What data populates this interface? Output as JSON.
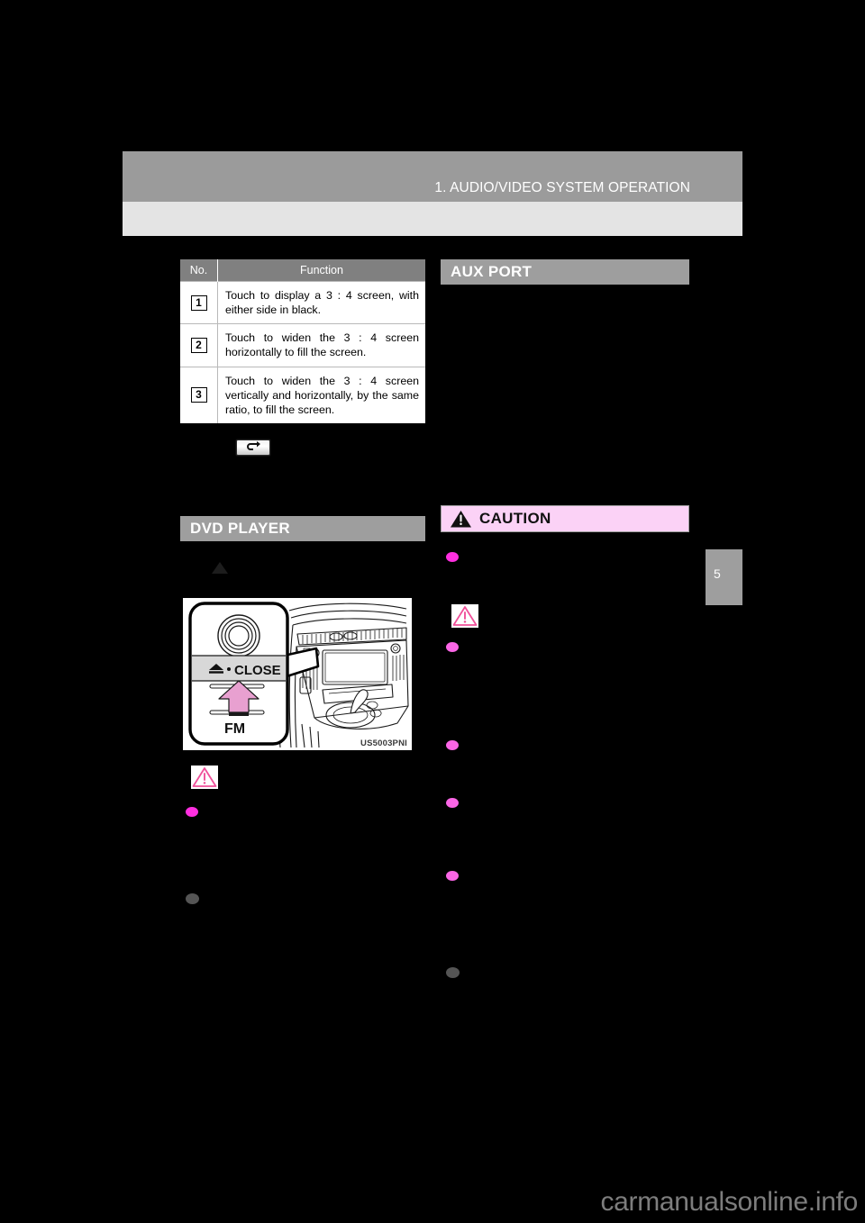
{
  "page": {
    "header_title": "1. AUDIO/VIDEO SYSTEM OPERATION",
    "chapter_tab_number": "5",
    "watermark": "carmanualsonline.info",
    "background_color": "#000000",
    "header_band_color": "#9b9b9b",
    "header_subband_color": "#e4e4e4"
  },
  "function_table": {
    "columns": [
      "No.",
      "Function"
    ],
    "rows": [
      {
        "no": "1",
        "function": "Touch to display a 3 : 4 screen, with either side in black."
      },
      {
        "no": "2",
        "function": "Touch to widen the 3 : 4 screen horizontally to fill the screen."
      },
      {
        "no": "3",
        "function": "Touch to widen the 3 : 4 screen vertically and horizontally, by the same ratio, to fill the screen."
      }
    ],
    "header_bg": "#808080",
    "header_fg": "#ffffff"
  },
  "return_button": {
    "icon": "return-arrow-icon"
  },
  "sections": {
    "dvd_player": {
      "title": "DVD PLAYER",
      "bar_color": "#9e9e9e"
    },
    "aux_port": {
      "title": "AUX PORT",
      "bar_color": "#9e9e9e"
    },
    "caution": {
      "title": "CAUTION",
      "box_color": "#fbd2f6",
      "border_color": "#9e9e9e",
      "icon": "warning-triangle-icon"
    }
  },
  "illustration": {
    "code": "US5003PNI",
    "callout_button_label": "CLOSE",
    "callout_eject_icon": "eject-icon",
    "band_label": "FM",
    "arrow_color": "#e8a0d0",
    "description": "Dashboard line drawing with callout of audio faceplate"
  },
  "bullets": {
    "pink": "#ff2fe0",
    "pink_soft": "#fb66e6",
    "gray": "#555555"
  },
  "icons": {
    "notice_triangle": "notice-triangle-icon",
    "eject_triangle": "eject-triangle-icon"
  }
}
